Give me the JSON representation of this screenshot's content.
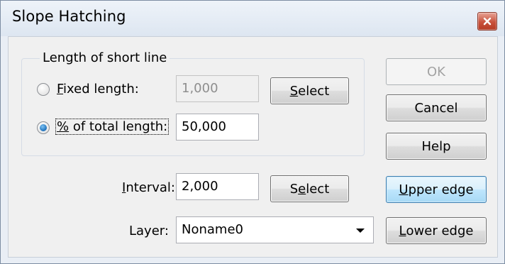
{
  "window": {
    "title": "Slope Hatching"
  },
  "group": {
    "title": "Length of short line"
  },
  "fixed_length": {
    "label_pre": "",
    "label_accel": "F",
    "label_post": "ixed length:",
    "value": "1,000",
    "selected": false
  },
  "percent_length": {
    "label_pre": "",
    "label_accel": "%",
    "label_post": " of total length:",
    "value": "50,000",
    "selected": true
  },
  "select_fixed": {
    "pre": "",
    "accel": "S",
    "post": "elect"
  },
  "interval": {
    "label_pre": "",
    "label_accel": "I",
    "label_post": "nterval:",
    "value": "2,000"
  },
  "select_interval": {
    "pre": "S",
    "accel": "e",
    "post": "lect"
  },
  "layer": {
    "label": "Layer:",
    "value": "Noname0"
  },
  "buttons": {
    "ok": "OK",
    "cancel": "Cancel",
    "help": "Help",
    "upper_edge_accel": "U",
    "upper_edge_rest": "pper edge",
    "lower_edge_accel": "L",
    "lower_edge_rest": "ower edge"
  },
  "colors": {
    "accent_default_button": "#a7d9f5",
    "close_button": "#c8523c"
  }
}
